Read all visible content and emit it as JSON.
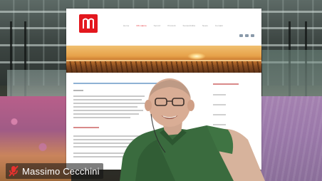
{
  "participant": {
    "name": "Massimo Cecchini",
    "mic_state": "muted",
    "mic_icon": "mic-muted-icon"
  },
  "background": {
    "kind": "virtual-background",
    "scene": "greenhouse with flower beds"
  },
  "shared_page": {
    "logo_icon": "brand-logo-icon",
    "brand_color": "#e3171e",
    "link_color": "#6a9bc9",
    "nav_items": [
      "Home",
      "Chi siamo",
      "Servizi",
      "Prodotti",
      "Sostenibilità",
      "News",
      "Contatti"
    ],
    "active_nav_index": 1,
    "hero": "sunset over plowed field"
  },
  "colors": {
    "name_tag_bg": "rgba(20,20,20,0.55)",
    "mic_muted": "#e8312f"
  }
}
